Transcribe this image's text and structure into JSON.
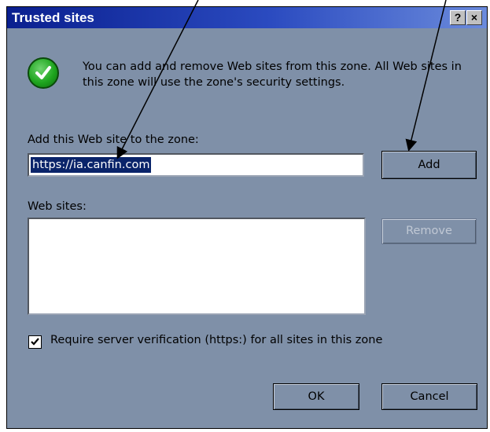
{
  "dialog": {
    "title": "Trusted sites",
    "help_glyph": "?",
    "close_glyph": "×"
  },
  "info": {
    "icon": "check-circle-icon",
    "text": "You can add and remove Web sites from this zone. All Web sites in this zone will use the zone's security settings."
  },
  "add_site": {
    "label": "Add this Web site to the zone:",
    "value": "https://ia.canfin.com",
    "add_button": "Add"
  },
  "web_sites": {
    "label": "Web sites:",
    "items": [],
    "remove_button": "Remove"
  },
  "verification": {
    "checked": true,
    "label": "Require server verification (https:) for all sites in this zone"
  },
  "footer": {
    "ok_button": "OK",
    "cancel_button": "Cancel"
  },
  "colors": {
    "dialog_bg": "#7f90a8",
    "titlebar_start": "#0a1f8f",
    "titlebar_end": "#6b8bdc",
    "check_green": "#1fa61f",
    "selection": "#0a246a"
  }
}
